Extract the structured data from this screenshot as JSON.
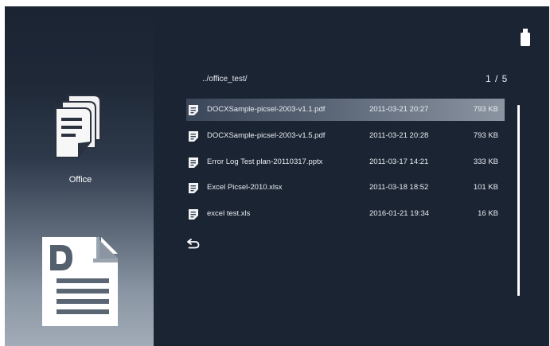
{
  "header": {
    "path": "../office_test/",
    "page_indicator": "1 / 5"
  },
  "sidebar": {
    "category_label": "Office",
    "category_icon": "office-documents-icon",
    "preview_icon": "word-doc-icon"
  },
  "files": [
    {
      "name": "DOCXSample-picsel-2003-v1.1.pdf",
      "date": "2011-03-21 20:27",
      "size": "793 KB",
      "selected": true
    },
    {
      "name": "DOCXSample-picsel-2003-v1.5.pdf",
      "date": "2011-03-21 20:28",
      "size": "793 KB",
      "selected": false
    },
    {
      "name": "Error Log Test  plan-20110317.pptx",
      "date": "2011-03-17 14:21",
      "size": "333 KB",
      "selected": false
    },
    {
      "name": "Excel Picsel-2010.xlsx",
      "date": "2011-03-18 18:52",
      "size": "101 KB",
      "selected": false
    },
    {
      "name": "excel test.xls",
      "date": "2016-01-21 19:34",
      "size": "16 KB",
      "selected": false
    }
  ],
  "back_icon": "return-arrow-icon",
  "device_icon": "usb-drive-icon",
  "colors": {
    "background": "#1b2433",
    "text": "#e9edf2",
    "selection": "#8b94a1"
  }
}
